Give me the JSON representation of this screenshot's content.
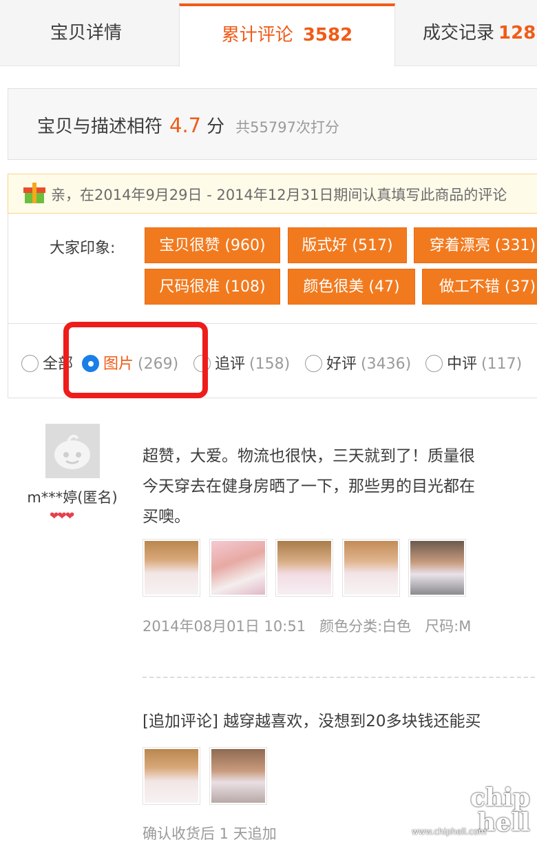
{
  "tabs": [
    {
      "label": "宝贝详情",
      "count": ""
    },
    {
      "label": "累计评论",
      "count": "3582"
    },
    {
      "label": "成交记录",
      "count": "128"
    }
  ],
  "rating": {
    "label": "宝贝与描述相符",
    "score": "4.7",
    "unit": "分",
    "total": "共55797次打分"
  },
  "promo": {
    "text": "亲，在2014年9月29日 - 2014年12月31日期间认真填写此商品的评论"
  },
  "impressions": {
    "label": "大家印象:",
    "tags": [
      "宝贝很赞 (960)",
      "版式好 (517)",
      "穿着漂亮 (331)",
      "尺码很准 (108)",
      "颜色很美 (47)",
      "做工不错 (37)"
    ]
  },
  "filters": [
    {
      "label": "全部",
      "count": ""
    },
    {
      "label": "图片",
      "count": "(269)"
    },
    {
      "label": "追评",
      "count": "(158)"
    },
    {
      "label": "好评",
      "count": "(3436)"
    },
    {
      "label": "中评",
      "count": "(117)"
    }
  ],
  "review": {
    "user": "m***婷(匿名)",
    "hearts": "❤❤❤",
    "lines": [
      "超赞，大爱。物流也很快，三天就到了！质量很",
      "今天穿去在健身房晒了一下，那些男的目光都在",
      "买噢。"
    ],
    "date": "2014年08月01日 10:51",
    "color": "颜色分类:白色",
    "size": "尺码:M",
    "append_text": "[追加评论] 越穿越喜欢，没想到20多块钱还能买",
    "append_meta": "确认收货后 1 天追加"
  },
  "watermark": {
    "big1": "chip",
    "big2": "hell",
    "small": "www.chiphell.com"
  },
  "colors": {
    "accent": "#f05b17",
    "tag": "#f27a1e",
    "radio_on": "#1a7fe6",
    "highlight": "#ef1c1c"
  }
}
